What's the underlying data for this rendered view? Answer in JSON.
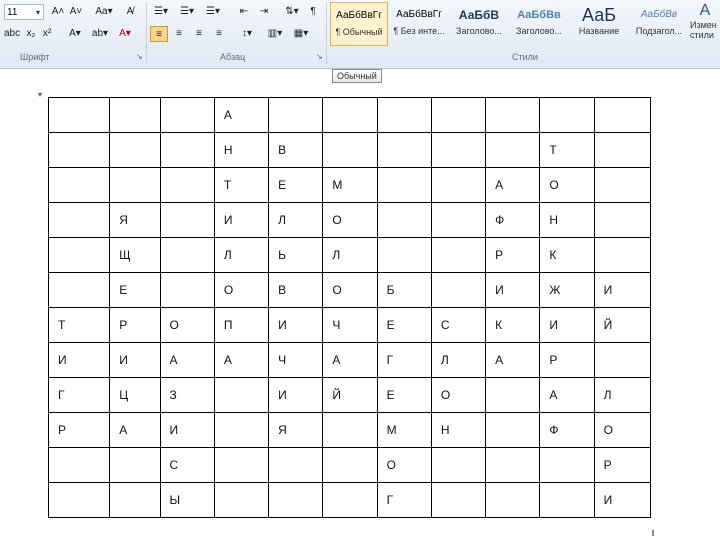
{
  "ribbon": {
    "font_size": "11",
    "font_group_label": "Шрифт",
    "paragraph_group_label": "Абзац",
    "styles_group_label": "Стили",
    "font_buttons_row1": [
      "A˄",
      "A˅",
      "Aa▾",
      "A̸"
    ],
    "font_buttons_row2": [
      "abc",
      "x₂",
      "x²",
      "A▾",
      "ab▾",
      "A▾"
    ],
    "para_buttons_row1": [
      "☰▾",
      "☰▾",
      "☰▾",
      "⇤",
      "⇥",
      "⇅▾",
      "¶"
    ],
    "para_buttons_row2": [
      "≡",
      "≡",
      "≡",
      "≡",
      "↕▾",
      "▥▾",
      "▦▾"
    ],
    "styles": [
      {
        "preview": "АаБбВвГг",
        "name": "¶ Обычный"
      },
      {
        "preview": "АаБбВвГг",
        "name": "¶ Без инте..."
      },
      {
        "preview": "АаБбВ",
        "name": "Заголово..."
      },
      {
        "preview": "АаБбВв",
        "name": "Заголово..."
      },
      {
        "preview": "АаБ",
        "name": "Название"
      },
      {
        "preview": "АаБбВв",
        "name": "Подзагол..."
      }
    ],
    "change_styles_label": "Измен стили",
    "tooltip": "Обычный"
  },
  "table": {
    "rows": [
      [
        "",
        "",
        "",
        "А",
        "",
        "",
        "",
        "",
        "",
        ""
      ],
      [
        "",
        "",
        "",
        "Н",
        "В",
        "",
        "",
        "",
        "",
        "Т"
      ],
      [
        "",
        "",
        "",
        "Т",
        "Е",
        "М",
        "",
        "",
        "А",
        "О"
      ],
      [
        "",
        "Я",
        "",
        "И",
        "Л",
        "О",
        "",
        "",
        "Ф",
        "Н"
      ],
      [
        "",
        "Щ",
        "",
        "Л",
        "Ь",
        "Л",
        "",
        "",
        "Р",
        "К"
      ],
      [
        "",
        "Е",
        "",
        "О",
        "В",
        "О",
        "Б",
        "",
        "И",
        "Ж",
        "И"
      ],
      [
        "Т",
        "Р",
        "О",
        "П",
        "И",
        "Ч",
        "Е",
        "С",
        "К",
        "И",
        "Й"
      ],
      [
        "И",
        "И",
        "А",
        "А",
        "Ч",
        "А",
        "Г",
        "Л",
        "А",
        "Р",
        ""
      ],
      [
        "Г",
        "Ц",
        "З",
        "",
        "И",
        "Й",
        "Е",
        "О",
        "",
        "А",
        "Л"
      ],
      [
        "Р",
        "А",
        "И",
        "",
        "Я",
        "",
        "М",
        "Н",
        "",
        "Ф",
        "О"
      ],
      [
        "",
        "",
        "С",
        "",
        "",
        "",
        "О",
        "",
        "",
        "",
        "Р"
      ],
      [
        "",
        "",
        "Ы",
        "",
        "",
        "",
        "Г",
        "",
        "",
        "",
        "И"
      ]
    ]
  }
}
